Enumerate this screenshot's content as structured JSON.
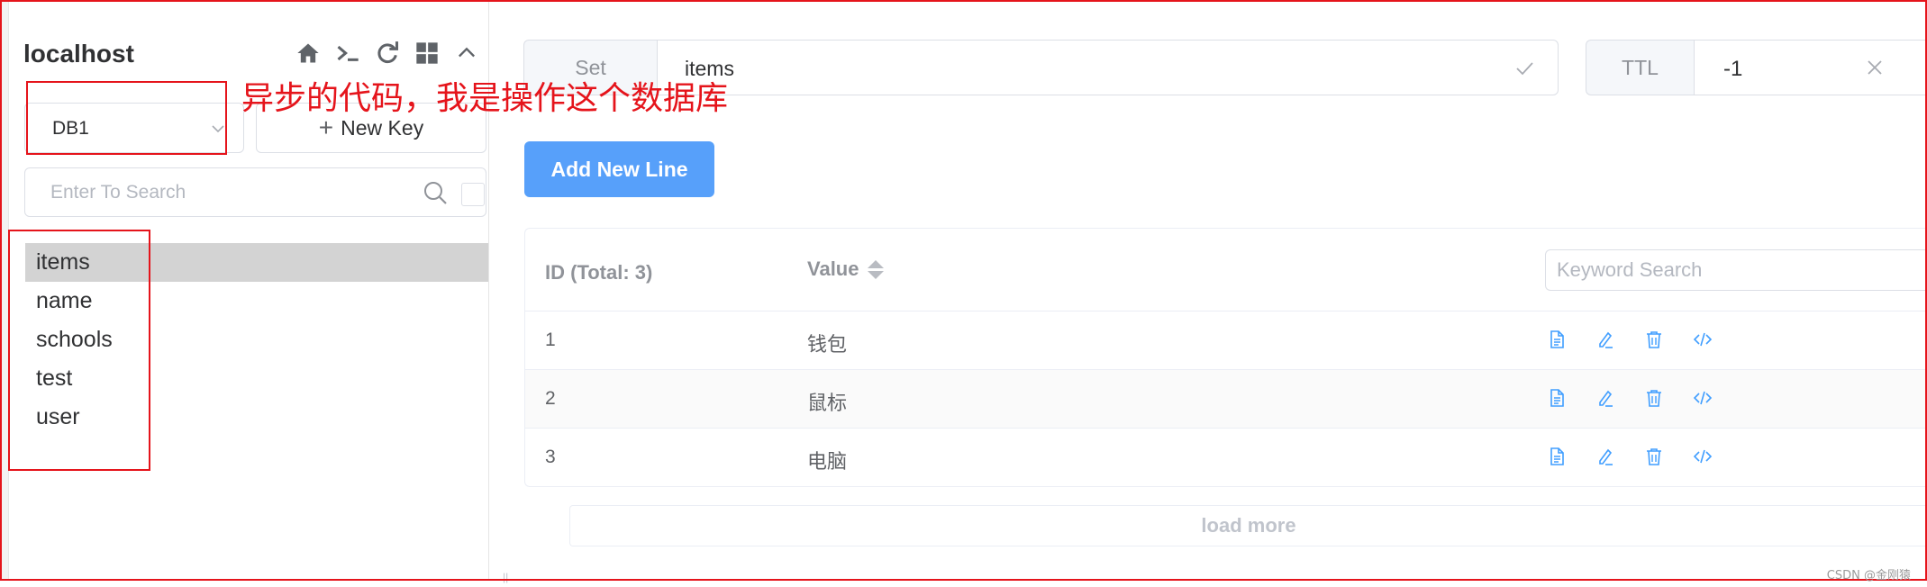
{
  "sidebar": {
    "connection_name": "localhost",
    "toolbar_icons": [
      "home-icon",
      "terminal-icon",
      "refresh-icon",
      "grid-icon",
      "chevron-up-icon"
    ],
    "db_select": {
      "value": "DB1"
    },
    "new_key_label": "New Key",
    "search": {
      "placeholder": "Enter To Search"
    },
    "keys": [
      {
        "label": "items",
        "active": true
      },
      {
        "label": "name"
      },
      {
        "label": "schools"
      },
      {
        "label": "test"
      },
      {
        "label": "user"
      }
    ]
  },
  "annotation": {
    "text": "异步的代码，我是操作这个数据库",
    "color": "#e5141b"
  },
  "key_header": {
    "type_label": "Set",
    "key_name": "items",
    "ttl_label": "TTL",
    "ttl_value": "-1"
  },
  "main": {
    "add_line_label": "Add New Line",
    "accent_color": "#57a0fa",
    "table": {
      "id_header": "ID (Total: 3)",
      "value_header": "Value",
      "keyword_placeholder": "Keyword Search",
      "rows": [
        {
          "id": "1",
          "value": "钱包"
        },
        {
          "id": "2",
          "value": "鼠标"
        },
        {
          "id": "3",
          "value": "电脑"
        }
      ],
      "row_actions": [
        "document-icon",
        "edit-icon",
        "delete-icon",
        "code-icon"
      ]
    },
    "load_more_label": "load more"
  },
  "watermark": "CSDN @金刚猿"
}
